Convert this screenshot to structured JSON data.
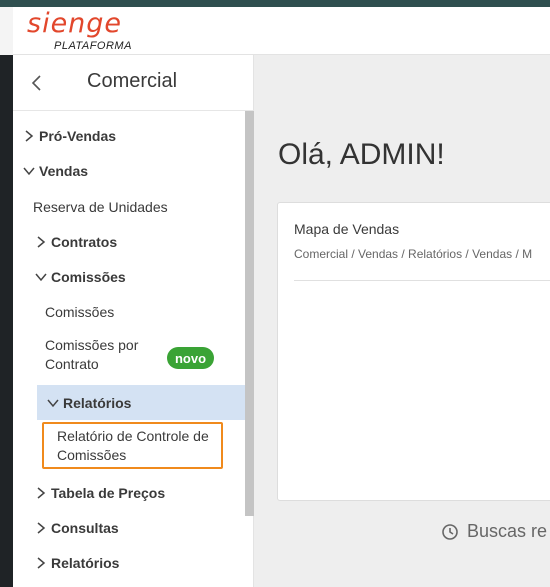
{
  "brand": {
    "logo_text": "sienge",
    "logo_subtitle": "PLATAFORMA",
    "accent": "#e2472c"
  },
  "sidebar": {
    "title": "Comercial",
    "back_icon": "chevron-left-icon",
    "items": [
      {
        "label": "Pró-Vendas",
        "expanded": false
      },
      {
        "label": "Vendas",
        "expanded": true
      },
      {
        "label": "Reserva de Unidades"
      },
      {
        "label": "Contratos",
        "expanded": false
      },
      {
        "label": "Comissões",
        "expanded": true
      },
      {
        "label": "Comissões"
      },
      {
        "label": "Comissões por\nContrato",
        "badge": "novo"
      },
      {
        "label": "Relatórios",
        "expanded": true,
        "active": true
      },
      {
        "label": "Relatório de Controle de\nComissões",
        "focused": true
      },
      {
        "label": "Tabela de Preços",
        "expanded": false
      },
      {
        "label": "Consultas",
        "expanded": false
      },
      {
        "label": "Relatórios",
        "expanded": false
      }
    ]
  },
  "main": {
    "greeting": "Olá, ADMIN!",
    "card": {
      "title": "Mapa de Vendas",
      "breadcrumb": "Comercial / Vendas / Relatórios / Vendas / M"
    },
    "recent_label": "Buscas re"
  },
  "colors": {
    "badge": "#3aa335",
    "active_row": "#d4e2f3",
    "focus_outline": "#f08a1c",
    "topbar": "#2f4f4f"
  }
}
